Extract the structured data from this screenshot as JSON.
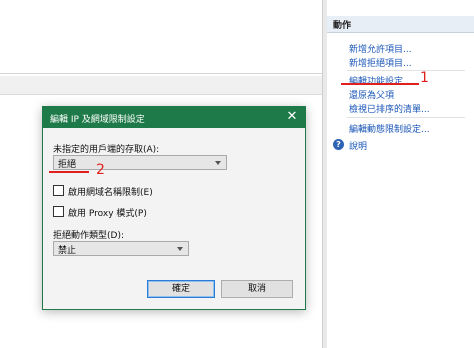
{
  "actions": {
    "header": "動作",
    "items": [
      "新增允許項目...",
      "新增拒絕項目...",
      "編輯功能設定...",
      "還原為父項",
      "檢視已排序的清單...",
      "編輯動態限制設定..."
    ],
    "help": "說明"
  },
  "annotations": {
    "marker_1": "1",
    "marker_2": "2",
    "color": "#e0201e"
  },
  "dialog": {
    "title": "編輯 IP 及網域限制設定",
    "close_glyph": "✕",
    "unspecified_label": "未指定的用戶端的存取(A):",
    "unspecified_value": "拒絕",
    "domain_check_label": "啟用網域名稱限制(E)",
    "proxy_check_label": "啟用 Proxy 模式(P)",
    "deny_action_label": "拒絕動作類型(D):",
    "deny_action_value": "禁止",
    "ok_label": "確定",
    "cancel_label": "取消",
    "accent_color": "#1e7a48"
  }
}
